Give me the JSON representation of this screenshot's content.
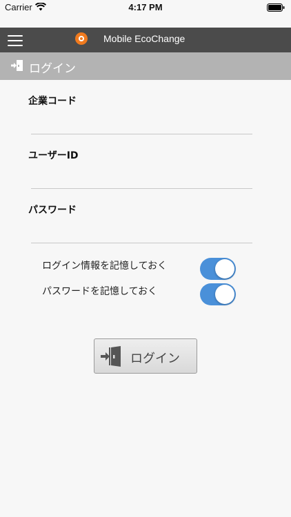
{
  "status_bar": {
    "carrier": "Carrier",
    "time": "4:17 PM"
  },
  "app_bar": {
    "title": "Mobile EcoChange"
  },
  "header": {
    "title": "ログイン"
  },
  "form": {
    "company_code": {
      "label": "企業コード",
      "value": "",
      "placeholder": ""
    },
    "user_id": {
      "label": "ユーザーID",
      "value": "",
      "placeholder": ""
    },
    "password": {
      "label": "パスワード",
      "value": "",
      "placeholder": ""
    }
  },
  "toggles": {
    "remember_login": {
      "label": "ログイン情報を記憶しておく",
      "on": true
    },
    "remember_password": {
      "label": "パスワードを記憶しておく",
      "on": true
    }
  },
  "login_button": {
    "label": "ログイン"
  },
  "colors": {
    "app_bar": "#4b4b4b",
    "header_band": "#b3b3b3",
    "toggle_on": "#4a90d9",
    "logo": "#f07a1e"
  },
  "icons": [
    "wifi-icon",
    "battery-icon",
    "menu-icon",
    "logo-icon",
    "login-door-icon"
  ]
}
